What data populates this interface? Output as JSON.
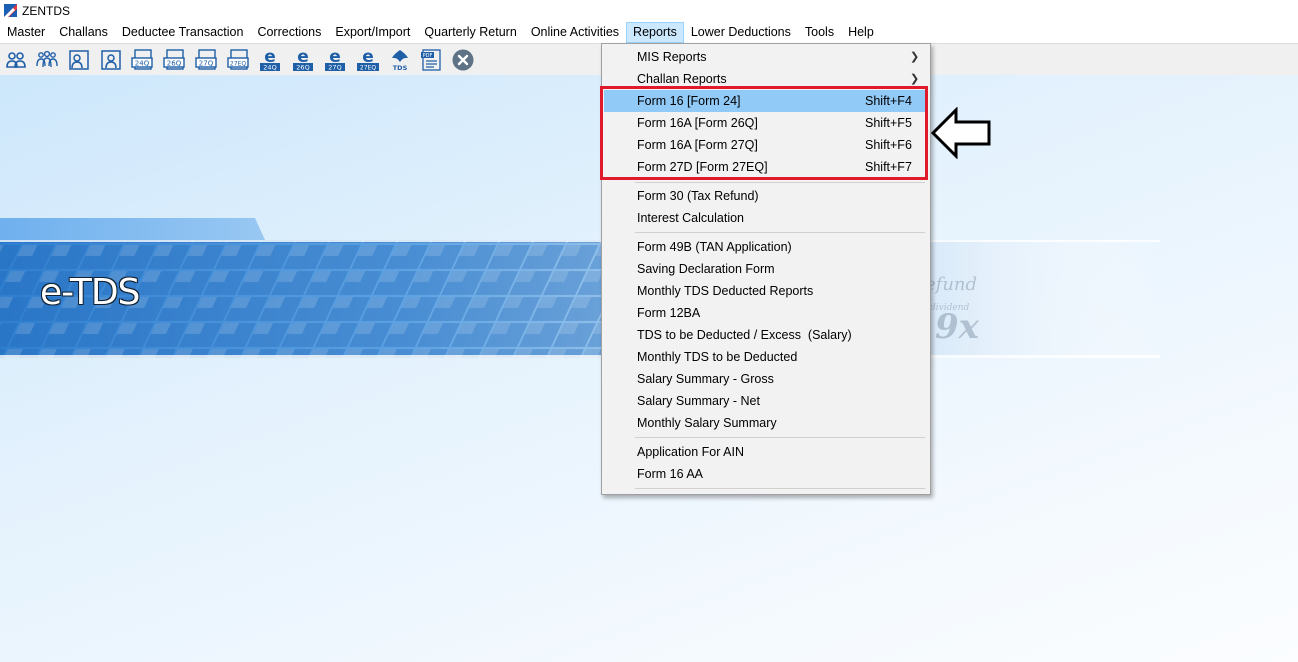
{
  "app": {
    "title": "ZENTDS"
  },
  "menubar": {
    "items": [
      "Master",
      "Challans",
      "Deductee Transaction",
      "Corrections",
      "Export/Import",
      "Quarterly Return",
      "Online Activities",
      "Reports",
      "Lower Deductions",
      "Tools",
      "Help"
    ],
    "active": "Reports"
  },
  "toolbar": {
    "icons": [
      "users-icon",
      "group-icon",
      "person-card-icon",
      "person-card-edit-icon",
      "form-24q-icon",
      "form-26q-icon",
      "form-27q-icon",
      "form-27eq-icon",
      "efile-24q-icon",
      "efile-26q-icon",
      "efile-27q-icon",
      "efile-27eq-icon",
      "tds-logo-icon",
      "pdf-icon",
      "document-icon",
      "close-circle-icon"
    ],
    "labels": {
      "f24q": "24Q",
      "f26q": "26Q",
      "f27q": "27Q",
      "f27eq": "27EQ",
      "e": "e",
      "tds": "TDS",
      "pdf": "PDF"
    }
  },
  "banner": {
    "text": "e-TDS"
  },
  "reports_menu": {
    "items": [
      {
        "label": "MIS Reports",
        "shortcut": "",
        "submenu": true
      },
      {
        "label": "Challan Reports",
        "shortcut": "",
        "submenu": true
      },
      {
        "label": "Form 16 [Form 24]",
        "shortcut": "Shift+F4",
        "highlighted": true
      },
      {
        "label": "Form 16A [Form 26Q]",
        "shortcut": "Shift+F5"
      },
      {
        "label": "Form 16A [Form 27Q]",
        "shortcut": "Shift+F6"
      },
      {
        "label": "Form 27D [Form 27EQ]",
        "shortcut": "Shift+F7"
      },
      {
        "label": "Form 30 (Tax Refund)",
        "shortcut": ""
      },
      {
        "label": "Interest Calculation",
        "shortcut": ""
      },
      {
        "label": "Form 49B (TAN Application)",
        "shortcut": ""
      },
      {
        "label": "Saving Declaration Form",
        "shortcut": ""
      },
      {
        "label": "Monthly TDS Deducted Reports",
        "shortcut": ""
      },
      {
        "label": "Form 12BA",
        "shortcut": ""
      },
      {
        "label": "TDS to be Deducted / Excess  (Salary)",
        "shortcut": ""
      },
      {
        "label": "Monthly TDS to be Deducted",
        "shortcut": ""
      },
      {
        "label": "Salary Summary - Gross",
        "shortcut": ""
      },
      {
        "label": "Salary Summary - Net",
        "shortcut": ""
      },
      {
        "label": "Monthly Salary Summary",
        "shortcut": ""
      },
      {
        "label": "Application For AIN",
        "shortcut": ""
      },
      {
        "label": "Form 16 AA",
        "shortcut": ""
      }
    ]
  },
  "colors": {
    "highlight": "#91c9f7",
    "annotation_red": "#e0192b",
    "icon_blue": "#1f5fa8"
  }
}
